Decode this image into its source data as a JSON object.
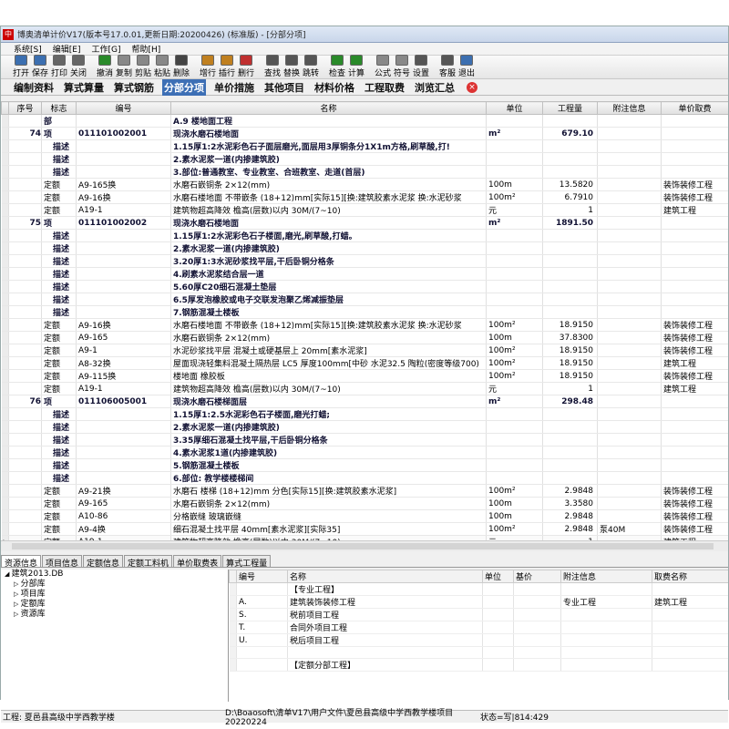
{
  "window": {
    "title": "博奥清单计价V17(版本号17.0.01,更新日期:20200426) (标准版) - [分部分项]"
  },
  "menu": [
    "系统[S]",
    "编辑[E]",
    "工作[G]",
    "帮助[H]"
  ],
  "toolbar": [
    {
      "label": "打开",
      "icon": "open-icon",
      "color": "#3c6fb0"
    },
    {
      "label": "保存",
      "icon": "save-icon",
      "color": "#3c6fb0"
    },
    {
      "label": "打印",
      "icon": "print-icon",
      "color": "#666666"
    },
    {
      "label": "关闭",
      "icon": "close-icon",
      "color": "#666666"
    },
    {
      "label": "撤消",
      "icon": "undo-icon",
      "color": "#2a8a2a"
    },
    {
      "label": "复制",
      "icon": "copy-icon",
      "color": "#888888"
    },
    {
      "label": "剪贴",
      "icon": "cut-icon",
      "color": "#888888"
    },
    {
      "label": "粘贴",
      "icon": "paste-icon",
      "color": "#888888"
    },
    {
      "label": "删除",
      "icon": "delete-icon",
      "color": "#444444"
    },
    {
      "label": "增行",
      "icon": "add-row-icon",
      "color": "#c08020"
    },
    {
      "label": "插行",
      "icon": "insert-row-icon",
      "color": "#c08020"
    },
    {
      "label": "删行",
      "icon": "delete-row-icon",
      "color": "#c03030"
    },
    {
      "label": "查找",
      "icon": "find-icon",
      "color": "#555555"
    },
    {
      "label": "替换",
      "icon": "replace-icon",
      "color": "#555555"
    },
    {
      "label": "跳转",
      "icon": "goto-icon",
      "color": "#555555"
    },
    {
      "label": "检查",
      "icon": "check-icon",
      "color": "#2a8a2a"
    },
    {
      "label": "计算",
      "icon": "calculate-icon",
      "color": "#2a8a2a"
    },
    {
      "label": "公式",
      "icon": "formula-icon",
      "color": "#888888"
    },
    {
      "label": "符号",
      "icon": "symbol-icon",
      "color": "#888888"
    },
    {
      "label": "设置",
      "icon": "settings-icon",
      "color": "#555555"
    },
    {
      "label": "客服",
      "icon": "support-icon",
      "color": "#555555"
    },
    {
      "label": "退出",
      "icon": "exit-icon",
      "color": "#3c6fb0"
    }
  ],
  "main_tabs": [
    "编制资料",
    "算式算量",
    "算式钢筋",
    "分部分项",
    "单价措施",
    "其他项目",
    "材料价格",
    "工程取费",
    "浏览汇总"
  ],
  "active_tab": 3,
  "columns": [
    "序号",
    "标志",
    "编号",
    "名称",
    "单位",
    "工程量",
    "附注信息",
    "单价取费"
  ],
  "rows": [
    {
      "seq": "",
      "flag": "部",
      "code": "",
      "name": "A.9 楼地面工程",
      "unit": "",
      "qty": "",
      "note": "",
      "fee": "",
      "style": "bold"
    },
    {
      "seq": "74",
      "flag": "项",
      "code": "011101002001",
      "name": "现浇水磨石楼地面",
      "unit": "m²",
      "qty": "679.10",
      "note": "",
      "fee": "",
      "style": "bold"
    },
    {
      "seq": "",
      "flag": "描述",
      "code": "",
      "name": "1.15厚1:2水泥彩色石子面层磨光,面层用3厚铜条分1X1m方格,刷草酸,打!",
      "unit": "",
      "qty": "",
      "note": "",
      "fee": "",
      "style": "bold"
    },
    {
      "seq": "",
      "flag": "描述",
      "code": "",
      "name": "2.素水泥浆一道(内掺建筑胶)",
      "unit": "",
      "qty": "",
      "note": "",
      "fee": "",
      "style": "bold"
    },
    {
      "seq": "",
      "flag": "描述",
      "code": "",
      "name": "3.部位:普通教室、专业教室、合班教室、走道(首层)",
      "unit": "",
      "qty": "",
      "note": "",
      "fee": "",
      "style": "bold"
    },
    {
      "seq": "",
      "flag": "定额",
      "code": "A9-165换",
      "name": "水磨石嵌铜条 2×12(mm)",
      "unit": "100m",
      "qty": "13.5820",
      "note": "",
      "fee": "装饰装修工程",
      "style": ""
    },
    {
      "seq": "",
      "flag": "定额",
      "code": "A9-16换",
      "name": "水磨石楼地面 不带嵌条 (18+12)mm[实际15][换:建筑胶素水泥浆 换:水泥砂浆",
      "unit": "100m²",
      "qty": "6.7910",
      "note": "",
      "fee": "装饰装修工程",
      "style": ""
    },
    {
      "seq": "",
      "flag": "定额",
      "code": "A19-1",
      "name": "建筑物超高降效 檐高(层数)以内 30M/(7~10)",
      "unit": "元",
      "qty": "1",
      "note": "",
      "fee": "建筑工程",
      "style": ""
    },
    {
      "seq": "75",
      "flag": "项",
      "code": "011101002002",
      "name": "现浇水磨石楼地面",
      "unit": "m²",
      "qty": "1891.50",
      "note": "",
      "fee": "",
      "style": "bold"
    },
    {
      "seq": "",
      "flag": "描述",
      "code": "",
      "name": "1.15厚1:2水泥彩色石子楼面,磨光,刷草酸,打蜡。",
      "unit": "",
      "qty": "",
      "note": "",
      "fee": "",
      "style": "bold"
    },
    {
      "seq": "",
      "flag": "描述",
      "code": "",
      "name": "2.素水泥浆一道(内掺建筑胶)",
      "unit": "",
      "qty": "",
      "note": "",
      "fee": "",
      "style": "bold"
    },
    {
      "seq": "",
      "flag": "描述",
      "code": "",
      "name": "3.20厚1:3水泥砂浆找平层,干后卧铜分格条",
      "unit": "",
      "qty": "",
      "note": "",
      "fee": "",
      "style": "bold"
    },
    {
      "seq": "",
      "flag": "描述",
      "code": "",
      "name": "4.刷素水泥浆结合层一道",
      "unit": "",
      "qty": "",
      "note": "",
      "fee": "",
      "style": "bold"
    },
    {
      "seq": "",
      "flag": "描述",
      "code": "",
      "name": "5.60厚C20细石混凝土垫层",
      "unit": "",
      "qty": "",
      "note": "",
      "fee": "",
      "style": "bold"
    },
    {
      "seq": "",
      "flag": "描述",
      "code": "",
      "name": "6.5厚发泡橡胶或电子交联发泡聚乙烯减振垫层",
      "unit": "",
      "qty": "",
      "note": "",
      "fee": "",
      "style": "bold"
    },
    {
      "seq": "",
      "flag": "描述",
      "code": "",
      "name": "7.钢筋混凝土楼板",
      "unit": "",
      "qty": "",
      "note": "",
      "fee": "",
      "style": "bold"
    },
    {
      "seq": "",
      "flag": "定额",
      "code": "A9-16换",
      "name": "水磨石楼地面 不带嵌条 (18+12)mm[实际15][换:建筑胶素水泥浆 换:水泥砂浆",
      "unit": "100m²",
      "qty": "18.9150",
      "note": "",
      "fee": "装饰装修工程",
      "style": ""
    },
    {
      "seq": "",
      "flag": "定额",
      "code": "A9-165",
      "name": "水磨石嵌铜条 2×12(mm)",
      "unit": "100m",
      "qty": "37.8300",
      "note": "",
      "fee": "装饰装修工程",
      "style": ""
    },
    {
      "seq": "",
      "flag": "定额",
      "code": "A9-1",
      "name": "水泥砂浆找平层 混凝土或硬基层上 20mm[素水泥浆]",
      "unit": "100m²",
      "qty": "18.9150",
      "note": "",
      "fee": "装饰装修工程",
      "style": ""
    },
    {
      "seq": "",
      "flag": "定额",
      "code": "A8-32换",
      "name": "屋面现浇轻集料混凝土隔热层 LC5 厚度100mm[中砂 水泥32.5 陶粒(密度等级700)",
      "unit": "100m²",
      "qty": "18.9150",
      "note": "",
      "fee": "建筑工程",
      "style": ""
    },
    {
      "seq": "",
      "flag": "定额",
      "code": "A9-115换",
      "name": "楼地面 橡胶板",
      "unit": "100m²",
      "qty": "18.9150",
      "note": "",
      "fee": "装饰装修工程",
      "style": ""
    },
    {
      "seq": "",
      "flag": "定额",
      "code": "A19-1",
      "name": "建筑物超高降效 檐高(层数)以内 30M/(7~10)",
      "unit": "元",
      "qty": "1",
      "note": "",
      "fee": "建筑工程",
      "style": ""
    },
    {
      "seq": "76",
      "flag": "项",
      "code": "011106005001",
      "name": "现浇水磨石楼梯面层",
      "unit": "m²",
      "qty": "298.48",
      "note": "",
      "fee": "",
      "style": "bold"
    },
    {
      "seq": "",
      "flag": "描述",
      "code": "",
      "name": "1.15厚1:2.5水泥彩色石子楼面,磨光打蜡;",
      "unit": "",
      "qty": "",
      "note": "",
      "fee": "",
      "style": "bold"
    },
    {
      "seq": "",
      "flag": "描述",
      "code": "",
      "name": "2.素水泥浆一道(内掺建筑胶)",
      "unit": "",
      "qty": "",
      "note": "",
      "fee": "",
      "style": "bold"
    },
    {
      "seq": "",
      "flag": "描述",
      "code": "",
      "name": "3.35厚细石混凝土找平层,干后卧铜分格条",
      "unit": "",
      "qty": "",
      "note": "",
      "fee": "",
      "style": "bold"
    },
    {
      "seq": "",
      "flag": "描述",
      "code": "",
      "name": "4.素水泥浆1道(内掺建筑胶)",
      "unit": "",
      "qty": "",
      "note": "",
      "fee": "",
      "style": "bold"
    },
    {
      "seq": "",
      "flag": "描述",
      "code": "",
      "name": "5.钢筋混凝土楼板",
      "unit": "",
      "qty": "",
      "note": "",
      "fee": "",
      "style": "bold"
    },
    {
      "seq": "",
      "flag": "描述",
      "code": "",
      "name": "6.部位: 教学楼楼梯间",
      "unit": "",
      "qty": "",
      "note": "",
      "fee": "",
      "style": "bold"
    },
    {
      "seq": "",
      "flag": "定额",
      "code": "A9-21换",
      "name": "水磨石 楼梯 (18+12)mm 分色[实际15][换:建筑胶素水泥浆]",
      "unit": "100m²",
      "qty": "2.9848",
      "note": "",
      "fee": "装饰装修工程",
      "style": ""
    },
    {
      "seq": "",
      "flag": "定额",
      "code": "A9-165",
      "name": "水磨石嵌铜条 2×12(mm)",
      "unit": "100m",
      "qty": "3.3580",
      "note": "",
      "fee": "装饰装修工程",
      "style": ""
    },
    {
      "seq": "",
      "flag": "定额",
      "code": "A10-86",
      "name": "分格嵌缝 玻璃嵌缝",
      "unit": "100m",
      "qty": "2.9848",
      "note": "",
      "fee": "装饰装修工程",
      "style": ""
    },
    {
      "seq": "",
      "flag": "定额",
      "code": "A9-4换",
      "name": "细石混凝土找平层 40mm[素水泥浆][实际35]",
      "unit": "100m²",
      "qty": "2.9848",
      "note": "泵40M",
      "fee": "装饰装修工程",
      "style": ""
    },
    {
      "seq": "",
      "flag": "定额",
      "code": "A19-1",
      "name": "建筑物超高降效 檐高(层数)以内 30M/(7~10)",
      "unit": "元",
      "qty": "1",
      "note": "",
      "fee": "建筑工程",
      "style": "current"
    }
  ],
  "bottom_tabs": [
    "资源信息",
    "项目信息",
    "定额信息",
    "定额工料机",
    "单价取费表",
    "算式工程量"
  ],
  "tree": [
    "建筑2013.DB",
    "分部库",
    "项目库",
    "定额库",
    "资源库"
  ],
  "right_columns": [
    "编号",
    "名称",
    "单位",
    "基价",
    "附注信息",
    "取费名称"
  ],
  "right_rows": [
    {
      "code": "",
      "name": "【专业工程】",
      "unit": "",
      "price": "",
      "note": "",
      "fee": ""
    },
    {
      "code": "A.",
      "name": "建筑装饰装修工程",
      "unit": "",
      "price": "",
      "note": "专业工程",
      "fee": "建筑工程"
    },
    {
      "code": "S.",
      "name": "税前项目工程",
      "unit": "",
      "price": "",
      "note": "",
      "fee": ""
    },
    {
      "code": "T.",
      "name": "合同外项目工程",
      "unit": "",
      "price": "",
      "note": "",
      "fee": ""
    },
    {
      "code": "U.",
      "name": "税后项目工程",
      "unit": "",
      "price": "",
      "note": "",
      "fee": ""
    },
    {
      "code": "",
      "name": "",
      "unit": "",
      "price": "",
      "note": "",
      "fee": ""
    },
    {
      "code": "",
      "name": "【定额分部工程】",
      "unit": "",
      "price": "",
      "note": "",
      "fee": ""
    }
  ],
  "status": {
    "project": "工程: 夏邑县高级中学西教学楼",
    "path": "D:\\Boaosoft\\清单V17\\用户文件\\夏邑县高级中学西教学楼项目20220224",
    "state": "状态=写|814:429"
  }
}
